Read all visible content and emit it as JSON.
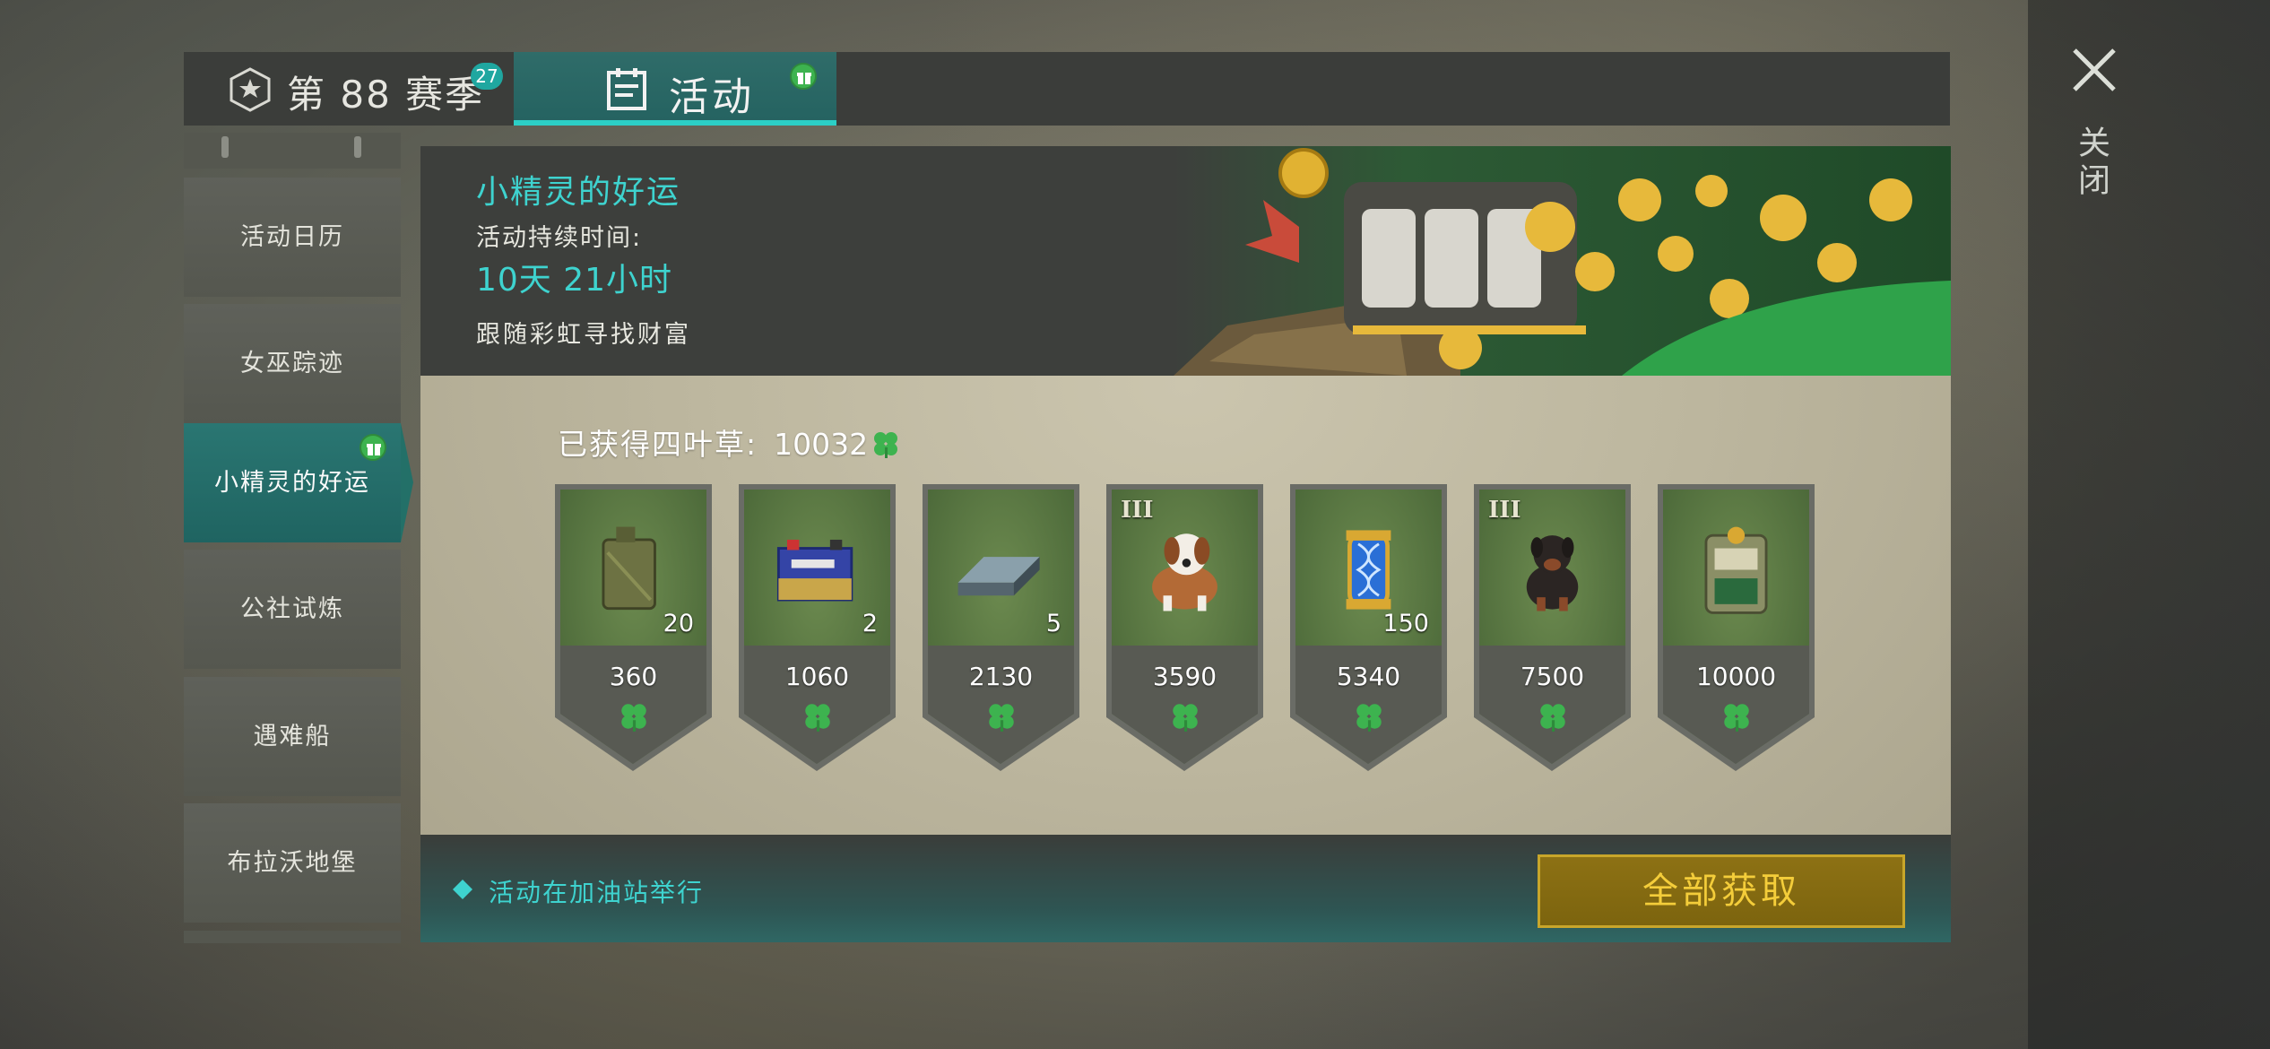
{
  "tabs": {
    "season_label": "第 88 赛季",
    "season_badge": "27",
    "activity_label": "活动"
  },
  "close_label": "关闭",
  "sidebar": {
    "items": [
      {
        "label": "活动日历",
        "active": false
      },
      {
        "label": "女巫踪迹",
        "active": false
      },
      {
        "label": "小精灵的好运",
        "active": true
      },
      {
        "label": "公社试炼",
        "active": false
      },
      {
        "label": "遇难船",
        "active": false
      },
      {
        "label": "布拉沃地堡",
        "active": false
      }
    ]
  },
  "banner": {
    "title": "小精灵的好运",
    "duration_label": "活动持续时间:",
    "duration": "10天 21小时",
    "description": "跟随彩虹寻找财富"
  },
  "earned": {
    "label": "已获得四叶草:",
    "value": "10032"
  },
  "rewards": [
    {
      "item": "fuel-canister",
      "qty": "20",
      "tier": "",
      "cost": "360"
    },
    {
      "item": "car-battery",
      "qty": "2",
      "tier": "",
      "cost": "1060"
    },
    {
      "item": "steel-ingot",
      "qty": "5",
      "tier": "",
      "cost": "2130"
    },
    {
      "item": "saint-bernard-dog",
      "qty": "",
      "tier": "III",
      "cost": "3590"
    },
    {
      "item": "dna-capsule",
      "qty": "150",
      "tier": "",
      "cost": "5340"
    },
    {
      "item": "rottweiler-dog",
      "qty": "",
      "tier": "III",
      "cost": "7500"
    },
    {
      "item": "slot-machine",
      "qty": "",
      "tier": "",
      "cost": "10000"
    }
  ],
  "footer": {
    "location_text": "活动在加油站举行",
    "claim_all_label": "全部获取"
  },
  "colors": {
    "accent_teal": "#3ed3cf",
    "tab_active": "#2a7672",
    "clover_green": "#3db34f",
    "button_gold": "#f4cd3a"
  }
}
